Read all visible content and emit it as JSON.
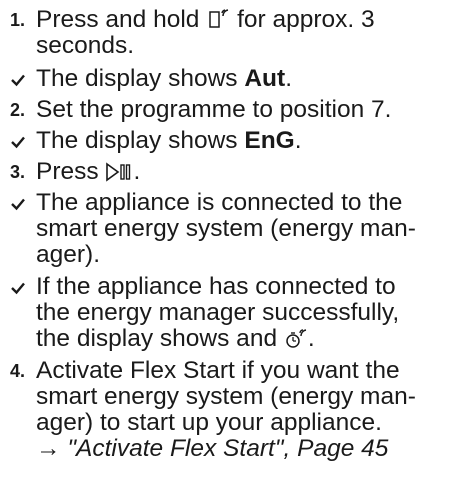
{
  "steps": [
    {
      "type": "numbered",
      "marker": "1.",
      "lines": [
        "Press and hold",
        "for approx. 3",
        "seconds."
      ],
      "icon": "remote-start-icon"
    },
    {
      "type": "result",
      "prefix": "The display shows ",
      "bold": "Aut",
      "suffix": "."
    },
    {
      "type": "numbered",
      "marker": "2.",
      "text": "Set the programme to position 7."
    },
    {
      "type": "result",
      "prefix": "The display shows ",
      "bold": "EnG",
      "suffix": "."
    },
    {
      "type": "numbered",
      "marker": "3.",
      "prefix": "Press",
      "suffix": ".",
      "icon": "start-pause-icon"
    },
    {
      "type": "result",
      "lines": [
        "The appliance is connected to the",
        "smart energy system (energy man-",
        "ager)."
      ]
    },
    {
      "type": "result",
      "lines": [
        "If the appliance has connected to",
        "the energy manager successfully,",
        "the display shows and"
      ],
      "suffix": ".",
      "icon": "flex-start-icon"
    },
    {
      "type": "numbered",
      "marker": "4.",
      "lines": [
        "Activate Flex Start if you want the",
        "smart energy system (energy man-",
        "ager) to start up your appliance."
      ],
      "link": {
        "arrow": "→",
        "text": "\"Activate Flex Start\", Page 45"
      }
    }
  ]
}
